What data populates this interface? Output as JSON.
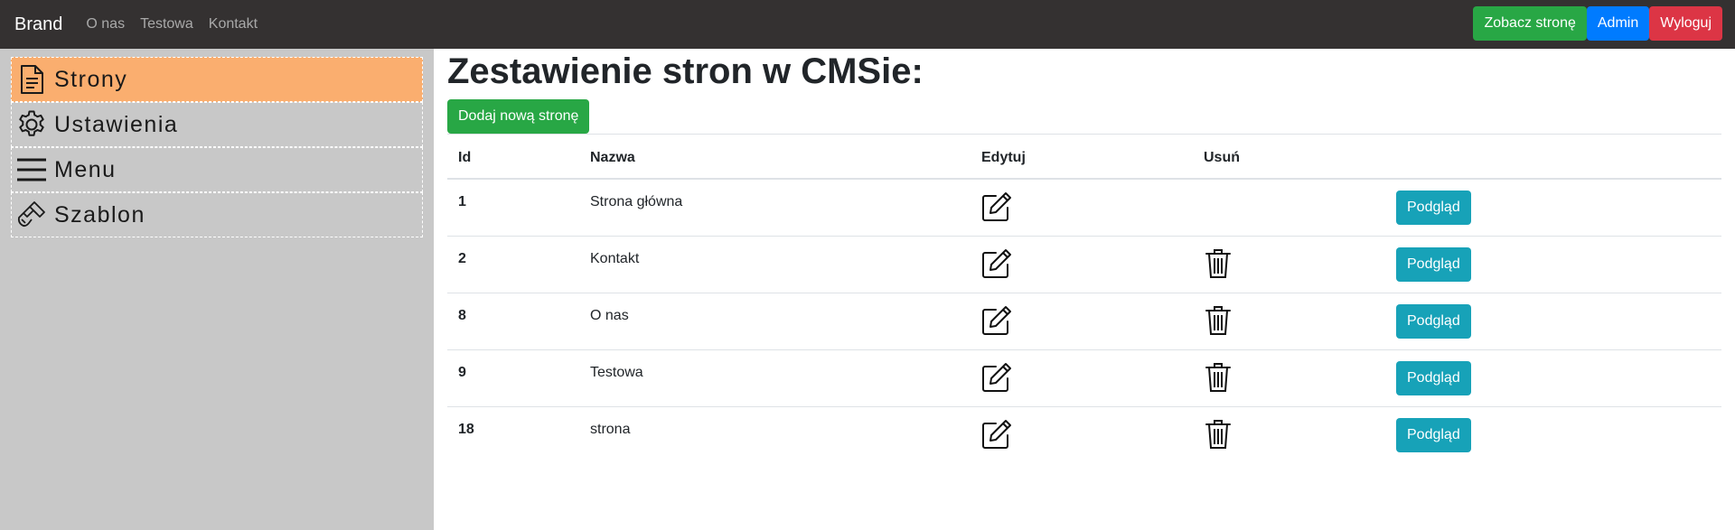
{
  "navbar": {
    "brand": "Brand",
    "links": [
      "O nas",
      "Testowa",
      "Kontakt"
    ],
    "view_site": "Zobacz stronę",
    "admin": "Admin",
    "logout": "Wyloguj"
  },
  "sidebar": {
    "items": [
      {
        "label": "Strony",
        "icon": "document-icon",
        "active": true
      },
      {
        "label": "Ustawienia",
        "icon": "gear-icon",
        "active": false
      },
      {
        "label": "Menu",
        "icon": "hamburger-icon",
        "active": false
      },
      {
        "label": "Szablon",
        "icon": "paint-brush-icon",
        "active": false
      }
    ]
  },
  "main": {
    "title": "Zestawienie stron w CMSie:",
    "add_button": "Dodaj nową stronę",
    "table": {
      "headers": {
        "id": "Id",
        "name": "Nazwa",
        "edit": "Edytuj",
        "delete": "Usuń"
      },
      "rows": [
        {
          "id": "1",
          "name": "Strona główna",
          "deletable": false,
          "preview": "Podgląd"
        },
        {
          "id": "2",
          "name": "Kontakt",
          "deletable": true,
          "preview": "Podgląd"
        },
        {
          "id": "8",
          "name": "O nas",
          "deletable": true,
          "preview": "Podgląd"
        },
        {
          "id": "9",
          "name": "Testowa",
          "deletable": true,
          "preview": "Podgląd"
        },
        {
          "id": "18",
          "name": "strona",
          "deletable": true,
          "preview": "Podgląd"
        }
      ]
    }
  },
  "colors": {
    "navbar_bg": "#343131",
    "sidebar_bg": "#c8c8c8",
    "sidebar_active": "#faae6f",
    "green": "#28a745",
    "blue": "#007bff",
    "red": "#dc3545",
    "teal": "#17a2b8"
  }
}
